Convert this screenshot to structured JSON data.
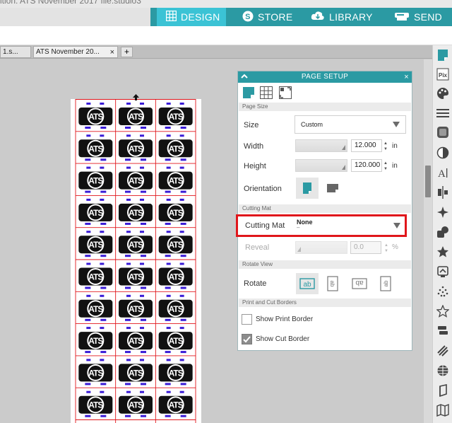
{
  "window": {
    "title": "ition: ATS November 2017 file.studio3"
  },
  "nav": {
    "design": "DESIGN",
    "store": "STORE",
    "library": "LIBRARY",
    "send": "SEND"
  },
  "tabs": [
    {
      "label": "1.s..."
    },
    {
      "label": "ATS November 20..."
    }
  ],
  "tab_add": "+",
  "tab_close": "×",
  "canvas": {
    "design_text": "ATS",
    "grid_columns": 3,
    "grid_rows_visible": 10
  },
  "panel": {
    "title": "PAGE SETUP",
    "close": "×",
    "page_size": {
      "section": "Page Size",
      "size_label": "Size",
      "size_value": "Custom",
      "width_label": "Width",
      "width_value": "12.000",
      "height_label": "Height",
      "height_value": "120.000",
      "unit": "in",
      "orientation_label": "Orientation"
    },
    "cutting_mat": {
      "section": "Cutting Mat",
      "label": "Cutting Mat",
      "value": "None",
      "sub": "–",
      "reveal_label": "Reveal",
      "reveal_value": "0.0",
      "reveal_unit": "%"
    },
    "rotate_view": {
      "section": "Rotate View",
      "label": "Rotate"
    },
    "borders": {
      "section": "Print and Cut Borders",
      "print_label": "Show Print Border",
      "print_checked": false,
      "cut_label": "Show Cut Border",
      "cut_checked": true
    }
  },
  "colors": {
    "teal": "#2b9aa3",
    "active_nav": "#3bc3d5",
    "highlight": "#e0161b",
    "cut_line": "#e0161b",
    "accent_dash": "#3a1bd6"
  }
}
